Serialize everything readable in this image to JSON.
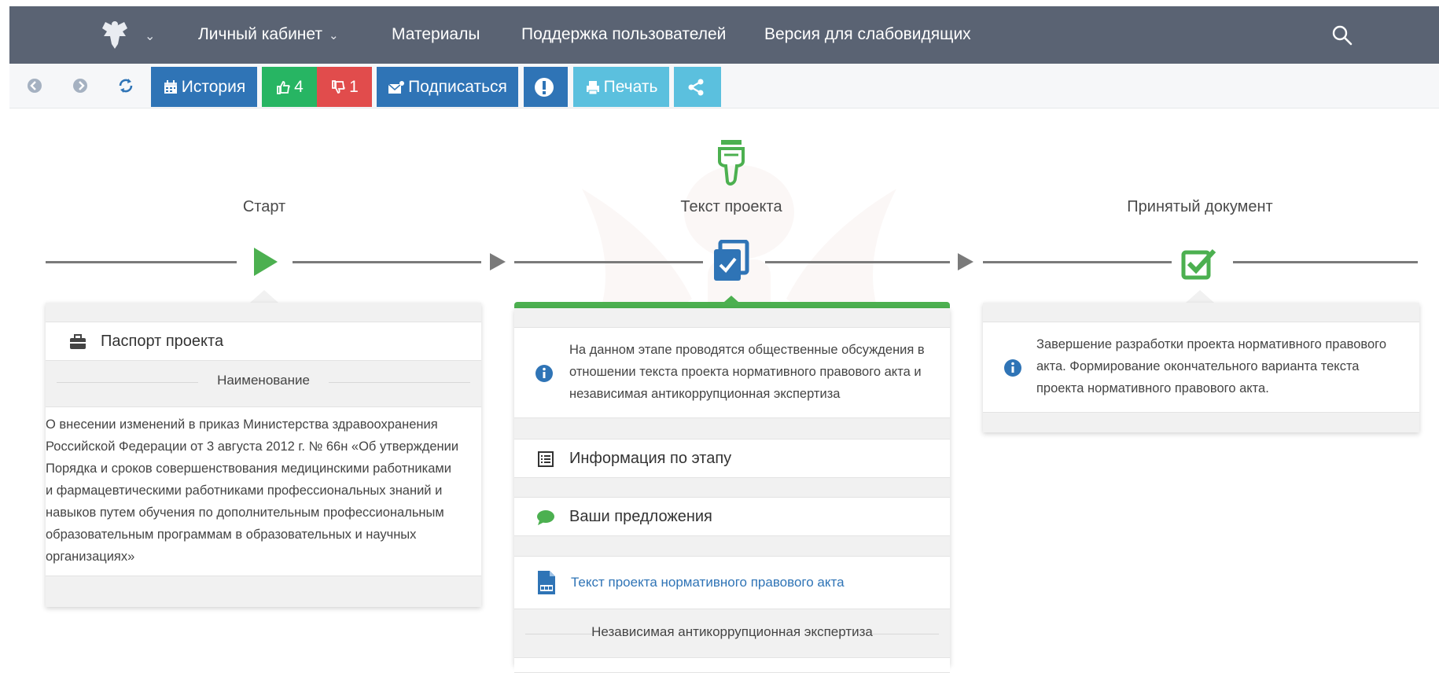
{
  "nav": {
    "items": [
      {
        "label": "Личный кабинет",
        "has_dropdown": true
      },
      {
        "label": "Материалы"
      },
      {
        "label": "Поддержка пользователей"
      },
      {
        "label": "Версия для слабовидящих"
      }
    ],
    "bg_color": "#5a6373"
  },
  "toolbar": {
    "history_label": "История",
    "likes": "4",
    "dislikes": "1",
    "subscribe_label": "Подписаться",
    "print_label": "Печать"
  },
  "stages": {
    "start": "Старт",
    "project_text": "Текст проекта",
    "accepted": "Принятый документ"
  },
  "left_card": {
    "passport_label": "Паспорт проекта",
    "section_title": "Наименование",
    "name_lines": [
      "О внесении изменений в приказ Министерства здравоохранения",
      "Российской Федерации от 3 августа 2012 г. № 66н «Об утверждении",
      "Порядка и сроков совершенствования медицинскими работниками",
      "и фармацевтическими работниками профессиональных знаний и",
      "навыков путем обучения по дополнительным профессиональным",
      "образовательным программам в образовательных и научных",
      "организациях»"
    ]
  },
  "middle_card": {
    "info_lines": [
      "На данном этапе проводятся общественные обсуждения в",
      "отношении текста проекта нормативного правового акта и",
      "независимая антикоррупционная экспертиза"
    ],
    "stage_info_label": "Информация по этапу",
    "proposals_label": "Ваши предложения",
    "doc_link_label": "Текст проекта нормативного правового акта",
    "expertise_title": "Независимая антикоррупционная экспертиза"
  },
  "right_card": {
    "info_lines": [
      "Завершение разработки проекта нормативного правового",
      "акта. Формирование окончательного варианта текста",
      "проекта нормативного правового акта."
    ]
  },
  "colors": {
    "accent_blue": "#2f74b6",
    "accent_green": "#27b563",
    "danger": "#e14c4c",
    "light_blue": "#5bc0de",
    "stage_green": "#4cb050"
  },
  "icons": [
    "emblem-icon",
    "search-icon",
    "back-icon",
    "forward-icon",
    "refresh-icon",
    "calendar-icon",
    "thumbs-up-icon",
    "thumbs-down-icon",
    "envelope-icon",
    "exclamation-icon",
    "print-icon",
    "share-icon",
    "pointing-hand-icon",
    "play-icon",
    "checked-doc-icon",
    "check-square-icon",
    "briefcase-icon",
    "info-icon",
    "list-icon",
    "comment-icon",
    "document-icon"
  ]
}
